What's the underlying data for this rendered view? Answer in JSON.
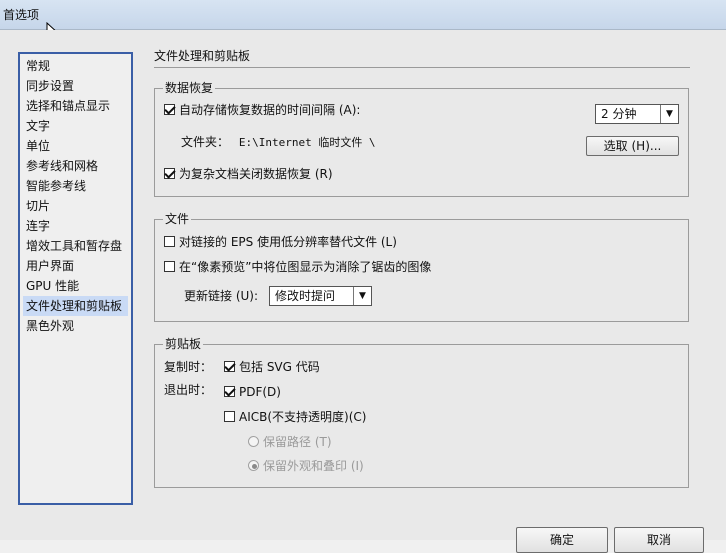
{
  "window": {
    "title": "首选项"
  },
  "sidebar": {
    "items": [
      {
        "label": "常规"
      },
      {
        "label": "同步设置"
      },
      {
        "label": "选择和锚点显示"
      },
      {
        "label": "文字"
      },
      {
        "label": "单位"
      },
      {
        "label": "参考线和网格"
      },
      {
        "label": "智能参考线"
      },
      {
        "label": "切片"
      },
      {
        "label": "连字"
      },
      {
        "label": "增效工具和暂存盘"
      },
      {
        "label": "用户界面"
      },
      {
        "label": "GPU 性能"
      },
      {
        "label": "文件处理和剪贴板",
        "selected": true
      },
      {
        "label": "黑色外观"
      }
    ]
  },
  "page": {
    "title": "文件处理和剪贴板"
  },
  "data_recovery": {
    "title": "数据恢复",
    "autosave_label": "自动存储恢复数据的时间间隔 (A):",
    "autosave_checked": true,
    "interval_value": "2 分钟",
    "folder_label": "文件夹：",
    "folder_path": "E:\\Internet 临时文件 \\",
    "choose_button": "选取 (H)...",
    "complex_label": "为复杂文档关闭数据恢复 (R)",
    "complex_checked": true
  },
  "files": {
    "title": "文件",
    "low_res_label": "对链接的 EPS 使用低分辨率替代文件 (L)",
    "low_res_checked": false,
    "antialias_label": "在“像素预览”中将位图显示为消除了锯齿的图像",
    "antialias_checked": false,
    "update_links_label": "更新链接 (U):",
    "update_links_value": "修改时提问"
  },
  "clipboard": {
    "title": "剪贴板",
    "copy_label": "复制时：",
    "svg_label": "包括 SVG 代码",
    "svg_checked": true,
    "exit_label": "退出时：",
    "pdf_label": "PDF(D)",
    "pdf_checked": true,
    "aicb_label": "AICB(不支持透明度)(C)",
    "aicb_checked": false,
    "preserve_paths_label": "保留路径 (T)",
    "preserve_appearance_label": "保留外观和叠印 (I)"
  },
  "footer": {
    "ok_label": "确定",
    "cancel_label": "取消"
  }
}
